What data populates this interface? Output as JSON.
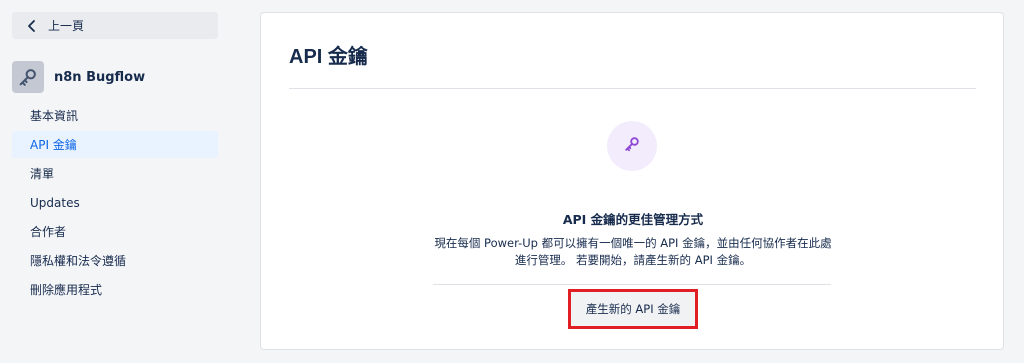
{
  "sidebar": {
    "back_label": "上一頁",
    "app_name": "n8n Bugflow",
    "items": [
      {
        "label": "基本資訊",
        "active": false
      },
      {
        "label": "API 金鑰",
        "active": true
      },
      {
        "label": "清單",
        "active": false
      },
      {
        "label": "Updates",
        "active": false
      },
      {
        "label": "合作者",
        "active": false
      },
      {
        "label": "隱私權和法令遵循",
        "active": false
      },
      {
        "label": "刪除應用程式",
        "active": false
      }
    ]
  },
  "main": {
    "title": "API 金鑰",
    "empty_state": {
      "icon": "key-icon",
      "heading": "API 金鑰的更佳管理方式",
      "description": "現在每個 Power-Up 都可以擁有一個唯一的 API 金鑰，並由任何協作者在此處進行管理。 若要開始，請產生新的 API 金鑰。",
      "button_label": "產生新的 API 金鑰"
    }
  },
  "colors": {
    "accent": "#0c66e4",
    "highlight_border": "#e01e24",
    "icon_bg": "#f3ecfd",
    "key_icon": "#8f47d6"
  }
}
